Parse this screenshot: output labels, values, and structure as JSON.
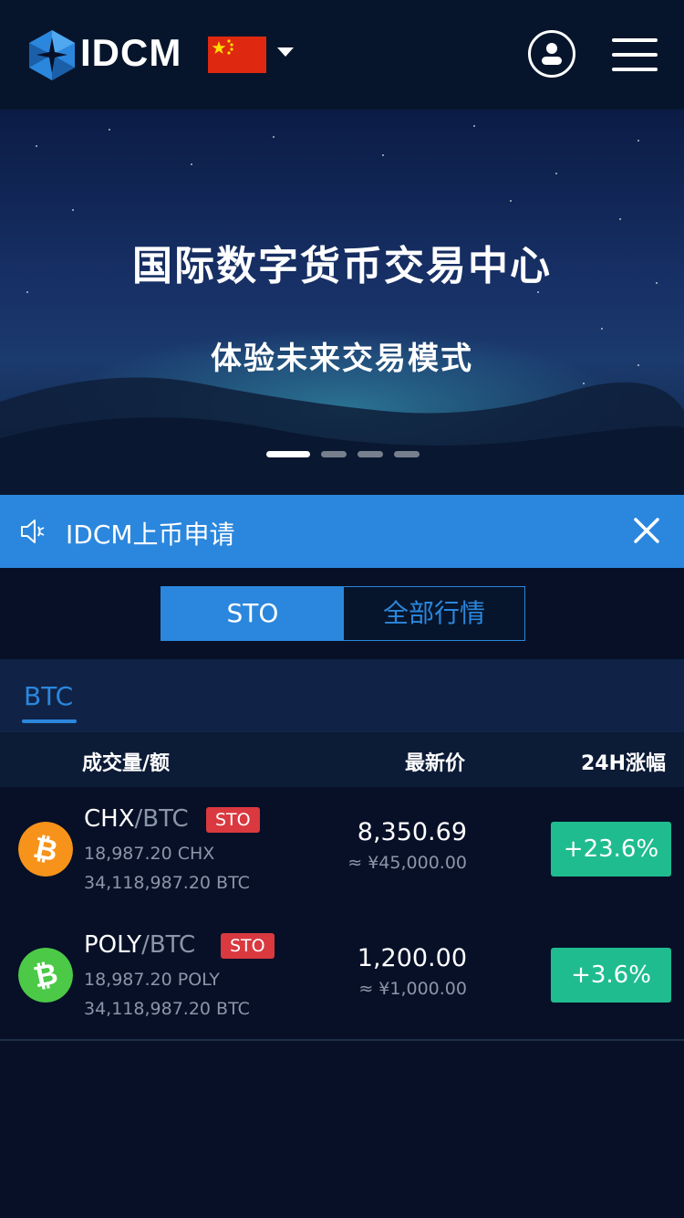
{
  "header": {
    "brand": "IDCM",
    "flag": "china-flag",
    "icons": {
      "logo": "idcm-cube-logo",
      "user": "user-icon",
      "menu": "hamburger-menu-icon",
      "dropdown": "caret-down-icon"
    }
  },
  "banner": {
    "title": "国际数字货币交易中心",
    "subtitle": "体验未来交易模式",
    "slides_total": 4,
    "active_slide": 1
  },
  "notice": {
    "text": "IDCM上币申请",
    "icons": {
      "speaker": "speaker-icon",
      "close": "close-icon"
    }
  },
  "toggle": {
    "sto_label": "STO",
    "all_label": "全部行情",
    "active": "STO"
  },
  "market_tabs": [
    {
      "label": "BTC",
      "active": true
    }
  ],
  "table": {
    "col_volume": "成交量/额",
    "col_price": "最新价",
    "col_change": "24H涨幅"
  },
  "rows": [
    {
      "icon": "bitcoin-orange-icon",
      "base": "CHX",
      "quote": "/BTC",
      "badge": "STO",
      "volume": "18,987.20 CHX",
      "amount": "34,118,987.20 BTC",
      "price": "8,350.69",
      "price_cny": "≈ ¥45,000.00",
      "change": "+23.6%"
    },
    {
      "icon": "bitcoin-cash-green-icon",
      "base": "POLY",
      "quote": "/BTC",
      "badge": "STO",
      "volume": "18,987.20 POLY",
      "amount": "34,118,987.20 BTC",
      "price": "1,200.00",
      "price_cny": "≈ ¥1,000.00",
      "change": "+3.6%"
    }
  ],
  "colors": {
    "accent": "#2b87dd",
    "positive": "#1fbc8f",
    "badge": "#d9393f",
    "background": "#071027"
  }
}
